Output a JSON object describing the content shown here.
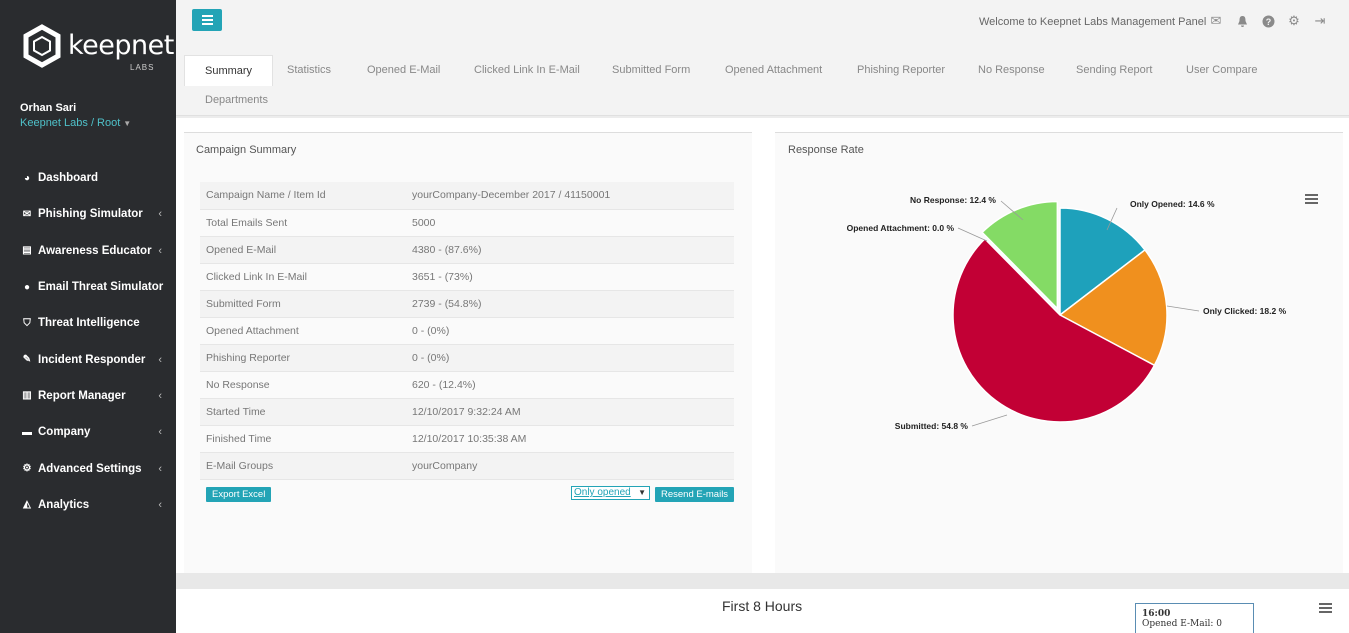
{
  "sidebar": {
    "logo_text": "keepnet",
    "logo_sub": "LABS",
    "user_name": "Orhan Sari",
    "user_org": "Keepnet Labs / Root",
    "items": [
      {
        "label": "Dashboard",
        "icon": "dashboard-icon",
        "has_chevron": false
      },
      {
        "label": "Phishing Simulator",
        "icon": "envelope-icon",
        "has_chevron": true
      },
      {
        "label": "Awareness Educator",
        "icon": "book-icon",
        "has_chevron": true
      },
      {
        "label": "Email Threat Simulator",
        "icon": "globe-icon",
        "has_chevron": false
      },
      {
        "label": "Threat Intelligence",
        "icon": "shield-icon",
        "has_chevron": false
      },
      {
        "label": "Incident Responder",
        "icon": "eraser-icon",
        "has_chevron": true
      },
      {
        "label": "Report Manager",
        "icon": "bar-chart-icon",
        "has_chevron": true
      },
      {
        "label": "Company",
        "icon": "briefcase-icon",
        "has_chevron": true
      },
      {
        "label": "Advanced Settings",
        "icon": "cogs-icon",
        "has_chevron": true
      },
      {
        "label": "Analytics",
        "icon": "area-chart-icon",
        "has_chevron": true
      }
    ]
  },
  "header": {
    "welcome": "Welcome to Keepnet Labs Management Panel",
    "icons": [
      "envelope-icon",
      "bell-icon",
      "help-icon",
      "cogs-icon",
      "logout-icon"
    ]
  },
  "tabs": [
    {
      "label": "Summary",
      "active": true
    },
    {
      "label": "Statistics"
    },
    {
      "label": "Opened E-Mail"
    },
    {
      "label": "Clicked Link In E-Mail"
    },
    {
      "label": "Submitted Form"
    },
    {
      "label": "Opened Attachment"
    },
    {
      "label": "Phishing Reporter"
    },
    {
      "label": "No Response"
    },
    {
      "label": "Sending Report"
    },
    {
      "label": "User Compare"
    },
    {
      "label": "Departments"
    }
  ],
  "campaign_summary": {
    "title": "Campaign Summary",
    "rows": [
      {
        "key": "Campaign Name / Item Id",
        "value": "yourCompany-December 2017 / 41150001"
      },
      {
        "key": "Total Emails Sent",
        "value": "5000"
      },
      {
        "key": "Opened E-Mail",
        "value": "4380 - (87.6%)"
      },
      {
        "key": "Clicked Link In E-Mail",
        "value": "3651 - (73%)"
      },
      {
        "key": "Submitted Form",
        "value": "2739 - (54.8%)"
      },
      {
        "key": "Opened Attachment",
        "value": "0 - (0%)"
      },
      {
        "key": "Phishing Reporter",
        "value": "0 - (0%)"
      },
      {
        "key": "No Response",
        "value": "620 - (12.4%)"
      },
      {
        "key": "Started Time",
        "value": "12/10/2017 9:32:24 AM"
      },
      {
        "key": "Finished Time",
        "value": "12/10/2017 10:35:38 AM"
      },
      {
        "key": "E-Mail Groups",
        "value": "yourCompany"
      }
    ],
    "export_label": "Export Excel",
    "filter_value": "Only opened",
    "resend_label": "Resend E-mails"
  },
  "response_rate": {
    "title": "Response Rate"
  },
  "chart_data": {
    "type": "pie",
    "title": "Response Rate",
    "slices": [
      {
        "name": "Only Opened",
        "value": 14.6,
        "label": "Only Opened: 14.6 %",
        "color": "#1ea1bb"
      },
      {
        "name": "Only Clicked",
        "value": 18.2,
        "label": "Only Clicked: 18.2 %",
        "color": "#f0901e"
      },
      {
        "name": "Submitted",
        "value": 54.8,
        "label": "Submitted: 54.8 %",
        "color": "#c20035"
      },
      {
        "name": "Opened Attachment",
        "value": 0.0,
        "label": "Opened Attachment: 0.0 %",
        "color": "#8085e9"
      },
      {
        "name": "No Response",
        "value": 12.4,
        "label": "No Response: 12.4 %",
        "color": "#84db65"
      }
    ]
  },
  "bottom_chart": {
    "title": "First 8 Hours",
    "tooltip_time": "16:00",
    "tooltip_text": "Opened E-Mail: 0"
  },
  "colors": {
    "accent": "#23a4b6",
    "sidebar_bg": "#2a2c2f"
  }
}
